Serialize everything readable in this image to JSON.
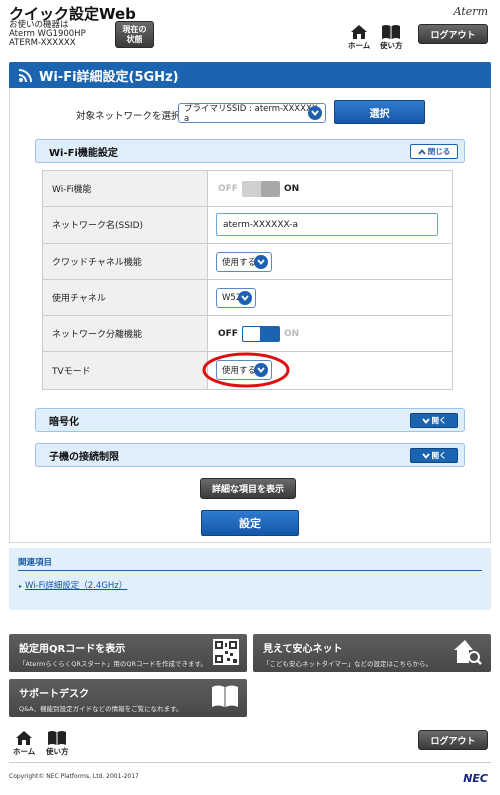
{
  "header": {
    "app_title": "クイック設定Web",
    "device_label": "お使いの機器は",
    "model": "Aterm WG1900HP",
    "ssid_name": "ATERM-XXXXXX",
    "status_button": "現在の\n状態",
    "logo": "Aterm",
    "nav_home": "ホーム",
    "nav_help": "使い方",
    "logout": "ログアウト"
  },
  "section": {
    "title": "Wi-Fi詳細設定(5GHz)"
  },
  "target_network": {
    "label": "対象ネットワークを選択",
    "selected": "プライマリSSID : aterm-XXXXXX-a",
    "select_button": "選択"
  },
  "wifi_panel": {
    "title": "Wi-Fi機能設定",
    "toggle": "閉じる",
    "rows": [
      {
        "label": "Wi-Fi機能",
        "type": "switch",
        "off": "OFF",
        "on": "ON",
        "state": "on-disabled"
      },
      {
        "label": "ネットワーク名(SSID)",
        "type": "text",
        "value": "aterm-XXXXXX-a"
      },
      {
        "label": "クワッドチャネル機能",
        "type": "select",
        "value": "使用する"
      },
      {
        "label": "使用チャネル",
        "type": "select",
        "value": "W52"
      },
      {
        "label": "ネットワーク分離機能",
        "type": "switch",
        "off": "OFF",
        "on": "ON",
        "state": "off"
      },
      {
        "label": "TVモード",
        "type": "select",
        "value": "使用する",
        "highlighted": true
      }
    ]
  },
  "encryption_panel": {
    "title": "暗号化",
    "toggle": "開く"
  },
  "child_panel": {
    "title": "子機の接続制限",
    "toggle": "開く"
  },
  "actions": {
    "show_details": "詳細な項目を表示",
    "apply": "設定"
  },
  "related": {
    "title": "関連項目",
    "link": "Wi-Fi詳細設定（2.4GHz）"
  },
  "cards": {
    "qr": {
      "title": "設定用QRコードを表示",
      "desc": "「AtermらくらくQRスタート」用のQRコードを作成できます。"
    },
    "safety": {
      "title": "見えて安心ネット",
      "desc": "「こども安心ネットタイマー」などの設定はこちらから。"
    },
    "support": {
      "title": "サポートデスク",
      "desc": "Q&A、機能別設定ガイドなどの情報をご覧になれます。"
    }
  },
  "footer": {
    "nav_home": "ホーム",
    "nav_help": "使い方",
    "logout": "ログアウト",
    "copyright": "Copyright© NEC Platforms, Ltd. 2001-2017",
    "brand": "NEC"
  },
  "colors": {
    "primary": "#1b64b0",
    "panel_bg": "#dfeefb",
    "highlight_ring": "#e01010",
    "card_bg": "#4e4e4e"
  }
}
